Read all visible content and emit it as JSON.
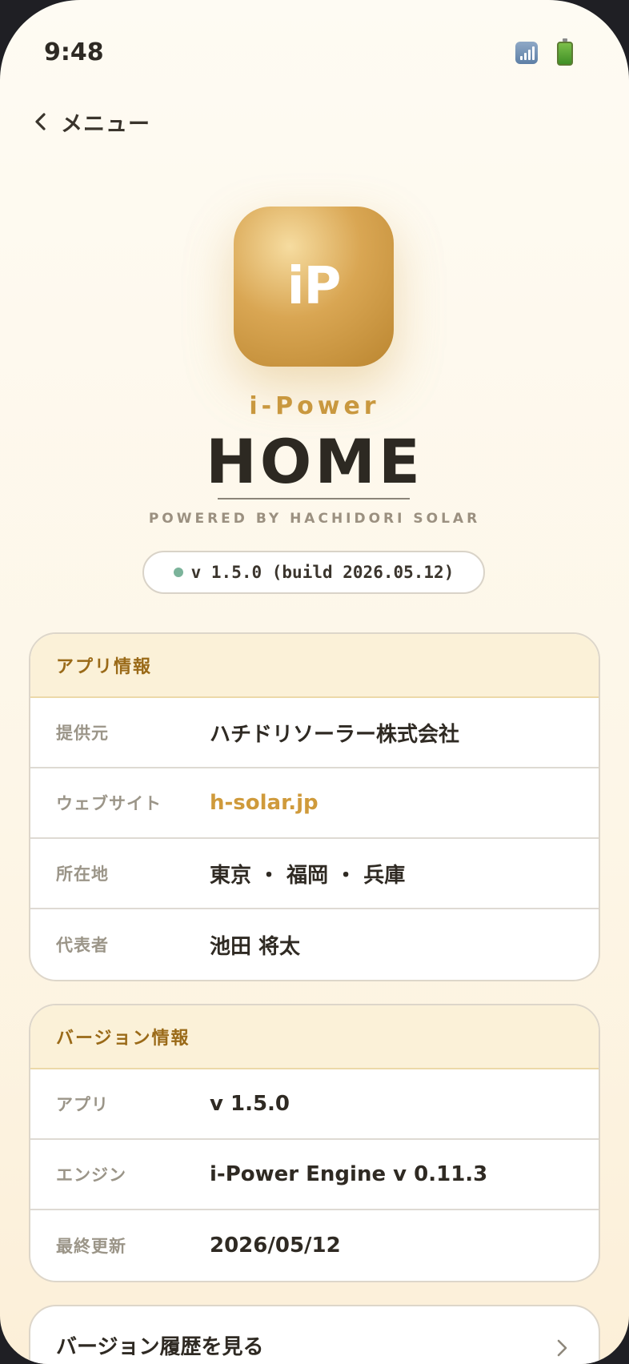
{
  "status_bar": {
    "time": "9:48"
  },
  "nav": {
    "back_label": "メニュー"
  },
  "app": {
    "icon_label": "iP",
    "brand_sub": "i-Power",
    "brand_title": "HOME",
    "powered_by": "POWERED BY HACHIDORI SOLAR",
    "version_badge": "v 1.5.0 (build 2026.05.12)",
    "status_color": "#7bb39a",
    "accent_color": "#cf9a3b"
  },
  "info_card": {
    "title": "アプリ情報",
    "rows": [
      {
        "key": "提供元",
        "value": "ハチドリソーラー株式会社"
      },
      {
        "key": "ウェブサイト",
        "value": "h-solar.jp"
      },
      {
        "key": "所在地",
        "value": "東京 ・ 福岡 ・ 兵庫"
      },
      {
        "key": "代表者",
        "value": "池田 将太"
      }
    ]
  },
  "version_card": {
    "title": "バージョン情報",
    "rows": [
      {
        "key": "アプリ",
        "value": "v 1.5.0"
      },
      {
        "key": "エンジン",
        "value": "i-Power Engine v 0.11.3"
      },
      {
        "key": "最終更新",
        "value": "2026/05/12"
      }
    ]
  },
  "history_button": {
    "label": "バージョン履歴を見る"
  }
}
